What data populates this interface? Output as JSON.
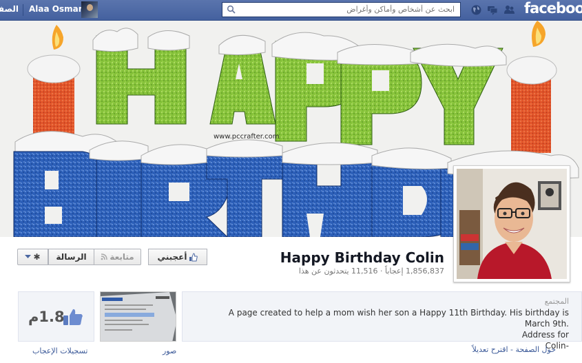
{
  "topbar": {
    "home_label": "الصفحة الرئيسية",
    "user_name": "Alaa Osman",
    "search_placeholder": "ابحث عن أشخاص وأماكن وأغراض",
    "logo": "facebook",
    "icons": [
      "globe-icon",
      "messages-icon",
      "friend-requests-icon",
      "search-icon"
    ]
  },
  "cover": {
    "watermark": "www.pccrafter.com"
  },
  "page": {
    "title": "Happy Birthday Colin",
    "stats": "1,856,837 إعجاباً · 11,516 يتحدثون عن هذا"
  },
  "actions": {
    "like": "أعجبني",
    "follow": "متابعة",
    "message": "الرسالة"
  },
  "likes": {
    "count": "1.8م",
    "label": "تسجيلات الإعجاب"
  },
  "photos": {
    "label": "صور"
  },
  "about": {
    "category": "المجتمع",
    "text": "A page created to help a mom wish her son a Happy 11th Birthday. His birthday is March 9th.\nAddress for\nColin-",
    "links": "حول الصفحة - اقترح تعديلاً"
  },
  "colors": {
    "brand": "#3b5998",
    "topbar": "#4b67a1"
  }
}
